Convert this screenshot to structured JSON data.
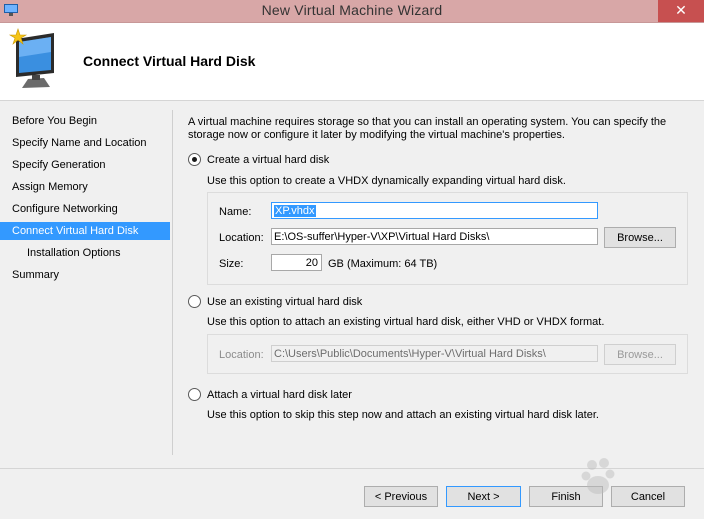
{
  "window": {
    "title": "New Virtual Machine Wizard",
    "close_glyph": "✕"
  },
  "header": {
    "title": "Connect Virtual Hard Disk"
  },
  "nav": {
    "items": [
      {
        "label": "Before You Begin"
      },
      {
        "label": "Specify Name and Location"
      },
      {
        "label": "Specify Generation"
      },
      {
        "label": "Assign Memory"
      },
      {
        "label": "Configure Networking"
      },
      {
        "label": "Connect Virtual Hard Disk"
      },
      {
        "label": "Installation Options"
      },
      {
        "label": "Summary"
      }
    ]
  },
  "intro": "A virtual machine requires storage so that you can install an operating system. You can specify the storage now or configure it later by modifying the virtual machine's properties.",
  "create": {
    "label": "Create a virtual hard disk",
    "description": "Use this option to create a VHDX dynamically expanding virtual hard disk.",
    "name_label": "Name:",
    "name_value": "XP.vhdx",
    "location_label": "Location:",
    "location_value": "E:\\OS-suffer\\Hyper-V\\XP\\Virtual Hard Disks\\",
    "browse_label": "Browse...",
    "size_label": "Size:",
    "size_value": "20",
    "size_unit": "GB (Maximum: 64 TB)"
  },
  "existing": {
    "label": "Use an existing virtual hard disk",
    "description": "Use this option to attach an existing virtual hard disk, either VHD or VHDX format.",
    "location_label": "Location:",
    "location_value": "C:\\Users\\Public\\Documents\\Hyper-V\\Virtual Hard Disks\\",
    "browse_label": "Browse..."
  },
  "later": {
    "label": "Attach a virtual hard disk later",
    "description": "Use this option to skip this step now and attach an existing virtual hard disk later."
  },
  "buttons": {
    "previous": "< Previous",
    "next": "Next >",
    "finish": "Finish",
    "cancel": "Cancel"
  },
  "colors": {
    "accent": "#3399ff",
    "titlebar": "#d8a7a7",
    "close": "#c75050"
  }
}
